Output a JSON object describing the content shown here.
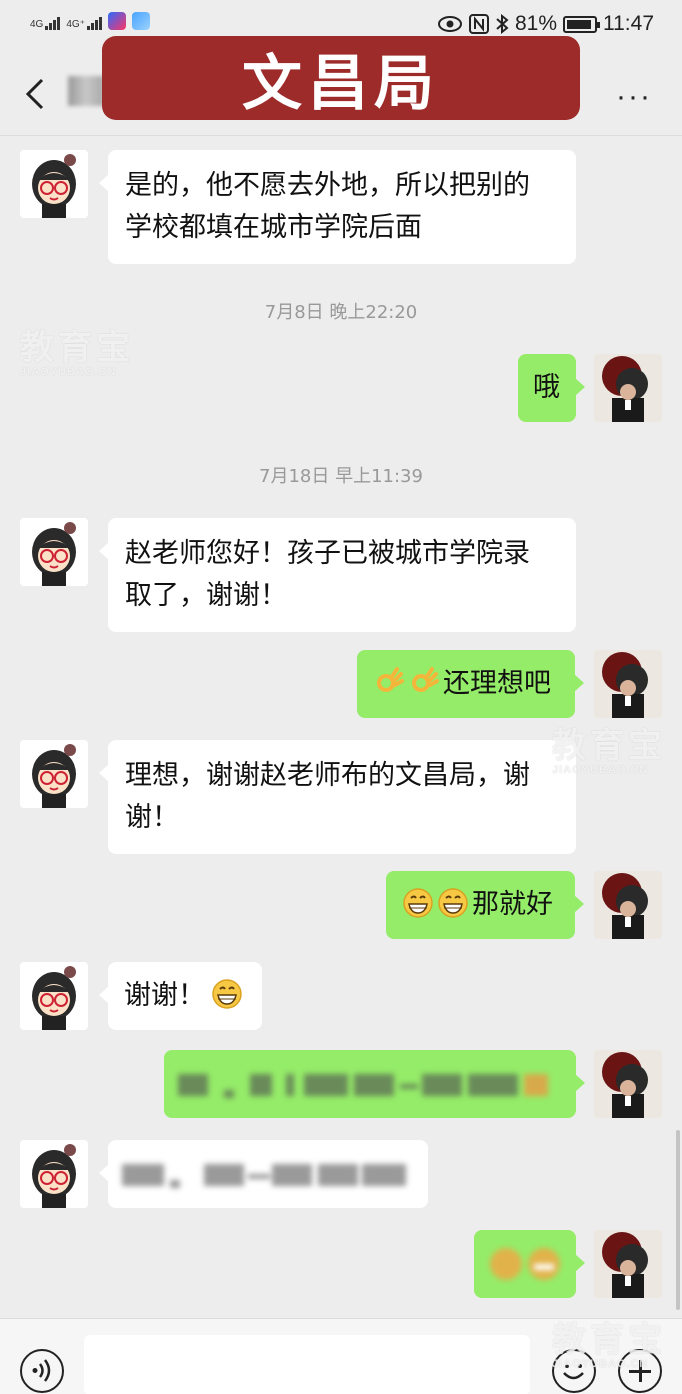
{
  "status_bar": {
    "signal1": "4G",
    "signal2": "4G⁺",
    "battery": "81%",
    "time": "11:47",
    "icons": [
      "eye-icon",
      "nfc-icon",
      "bluetooth-icon",
      "battery-icon"
    ]
  },
  "nav": {
    "banner": "文昌局",
    "more": "···"
  },
  "messages": [
    {
      "side": "in",
      "text_line1": "是的，他不愿去外地，所以把别的",
      "text_line2": "学校都填在城市学院后面"
    },
    {
      "side": "timestamp",
      "text": "7月8日 晚上22:20"
    },
    {
      "side": "out",
      "text": "哦"
    },
    {
      "side": "timestamp",
      "text": "7月18日 早上11:39"
    },
    {
      "side": "in",
      "text_line1": "赵老师您好！孩子已被城市学院录",
      "text_line2": "取了，谢谢！"
    },
    {
      "side": "out",
      "text": "还理想吧",
      "emoji": [
        "ok-hand-emoji",
        "ok-hand-emoji"
      ]
    },
    {
      "side": "in",
      "text_line1": "理想，谢谢赵老师布的文昌局，谢",
      "text_line2": "谢！"
    },
    {
      "side": "out",
      "text": "那就好",
      "emoji": [
        "grin-emoji",
        "grin-emoji"
      ]
    },
    {
      "side": "in",
      "text": "谢谢！",
      "emoji": [
        "grin-emoji"
      ]
    }
  ],
  "watermark": {
    "text": "教育宝",
    "sub": "JIAOYUBAO.CN"
  },
  "colors": {
    "banner": "#9d2b2a",
    "outgoing_bubble": "#95ec69",
    "incoming_bubble": "#ffffff",
    "background": "#ededed"
  }
}
